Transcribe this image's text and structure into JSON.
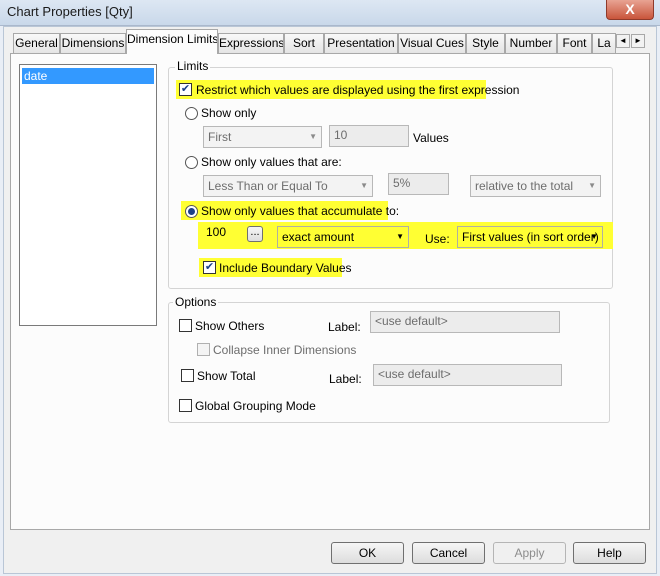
{
  "window": {
    "title": "Chart Properties [Qty]",
    "close_glyph": "X"
  },
  "tabs": [
    "General",
    "Dimensions",
    "Dimension Limits",
    "Expressions",
    "Sort",
    "Presentation",
    "Visual Cues",
    "Style",
    "Number",
    "Font",
    "La"
  ],
  "tab_scroll": {
    "left": "◄",
    "right": "►"
  },
  "dimension_list": {
    "selected": "date"
  },
  "limits": {
    "group_label": "Limits",
    "restrict_label": "Restrict which values are displayed using the first expression",
    "restrict_checked": "✔",
    "show_only_label": "Show only",
    "show_only_select": "First",
    "show_only_count": "10",
    "values_label": "Values",
    "show_only_values_label": "Show only values that are:",
    "comparison_select": "Less Than or Equal To",
    "percent_value": "5%",
    "relative_select": "relative to the total",
    "accumulate_label": "Show only values that accumulate to:",
    "accumulate_value": "100",
    "ellipsis_button": "...",
    "amount_select": "exact amount",
    "use_label": "Use:",
    "use_select": "First values (in sort order)",
    "include_boundary_label": "Include Boundary Values",
    "include_boundary_checked": "✔"
  },
  "options": {
    "group_label": "Options",
    "show_others_label": "Show Others",
    "others_label_caption": "Label:",
    "others_label_placeholder": "<use default>",
    "collapse_label": "Collapse Inner Dimensions",
    "show_total_label": "Show Total",
    "total_label_caption": "Label:",
    "total_label_placeholder": "<use default>",
    "global_grouping_label": "Global Grouping Mode"
  },
  "footer": {
    "ok": "OK",
    "cancel": "Cancel",
    "apply": "Apply",
    "help": "Help"
  },
  "colors": {
    "highlight": "#ffff33",
    "selection": "#3399ff"
  }
}
